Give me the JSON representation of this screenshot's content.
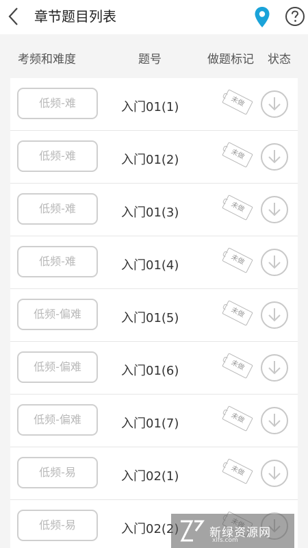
{
  "header": {
    "title": "章节题目列表"
  },
  "columns": {
    "frequency": "考频和难度",
    "number": "题号",
    "mark": "做题标记",
    "status": "状态"
  },
  "rows": [
    {
      "tag": "低频-难",
      "number": "入门01(1)",
      "stamp": "未做"
    },
    {
      "tag": "低频-难",
      "number": "入门01(2)",
      "stamp": "未做"
    },
    {
      "tag": "低频-难",
      "number": "入门01(3)",
      "stamp": "未做"
    },
    {
      "tag": "低频-难",
      "number": "入门01(4)",
      "stamp": "未做"
    },
    {
      "tag": "低频-偏难",
      "number": "入门01(5)",
      "stamp": "未做"
    },
    {
      "tag": "低频-偏难",
      "number": "入门01(6)",
      "stamp": "未做"
    },
    {
      "tag": "低频-偏难",
      "number": "入门01(7)",
      "stamp": "未做"
    },
    {
      "tag": "低频-易",
      "number": "入门02(1)",
      "stamp": "未做"
    },
    {
      "tag": "低频-易",
      "number": "入门02(2)",
      "stamp": "未做"
    }
  ],
  "watermark": {
    "text": "新绿资源网",
    "url": "xlfs.com"
  },
  "icons": {
    "back": "chevron-left-icon",
    "location": "location-pin-icon",
    "help": "question-circle-icon",
    "download": "download-circle-icon"
  },
  "colors": {
    "accent": "#1aa3d9",
    "tag_border": "#cfcfcf",
    "tag_text": "#b9b9b9",
    "icon_gray": "#c8c8c8"
  }
}
